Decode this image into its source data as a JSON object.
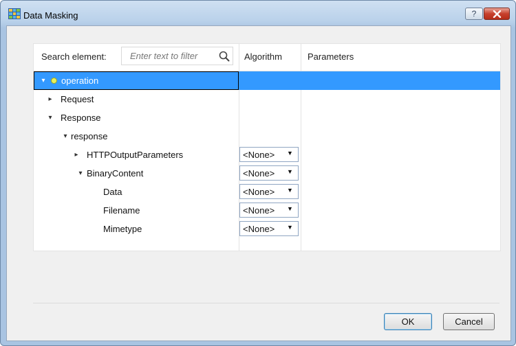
{
  "window": {
    "title": "Data Masking",
    "help_label": "?"
  },
  "search": {
    "label": "Search element:",
    "placeholder": "Enter text to filter"
  },
  "columns": {
    "algorithm": "Algorithm",
    "parameters": "Parameters"
  },
  "tree": {
    "rows": [
      {
        "label": "operation"
      },
      {
        "label": "Request"
      },
      {
        "label": "Response"
      },
      {
        "label": "response"
      },
      {
        "label": "HTTPOutputParameters",
        "algorithm": "<None>"
      },
      {
        "label": "BinaryContent",
        "algorithm": "<None>"
      },
      {
        "label": "Data",
        "algorithm": "<None>"
      },
      {
        "label": "Filename",
        "algorithm": "<None>"
      },
      {
        "label": "Mimetype",
        "algorithm": "<None>"
      }
    ]
  },
  "buttons": {
    "ok": "OK",
    "cancel": "Cancel"
  },
  "colors": {
    "selection": "#3399ff",
    "title_gradient": "#b9d1ea",
    "close": "#c7402c"
  }
}
